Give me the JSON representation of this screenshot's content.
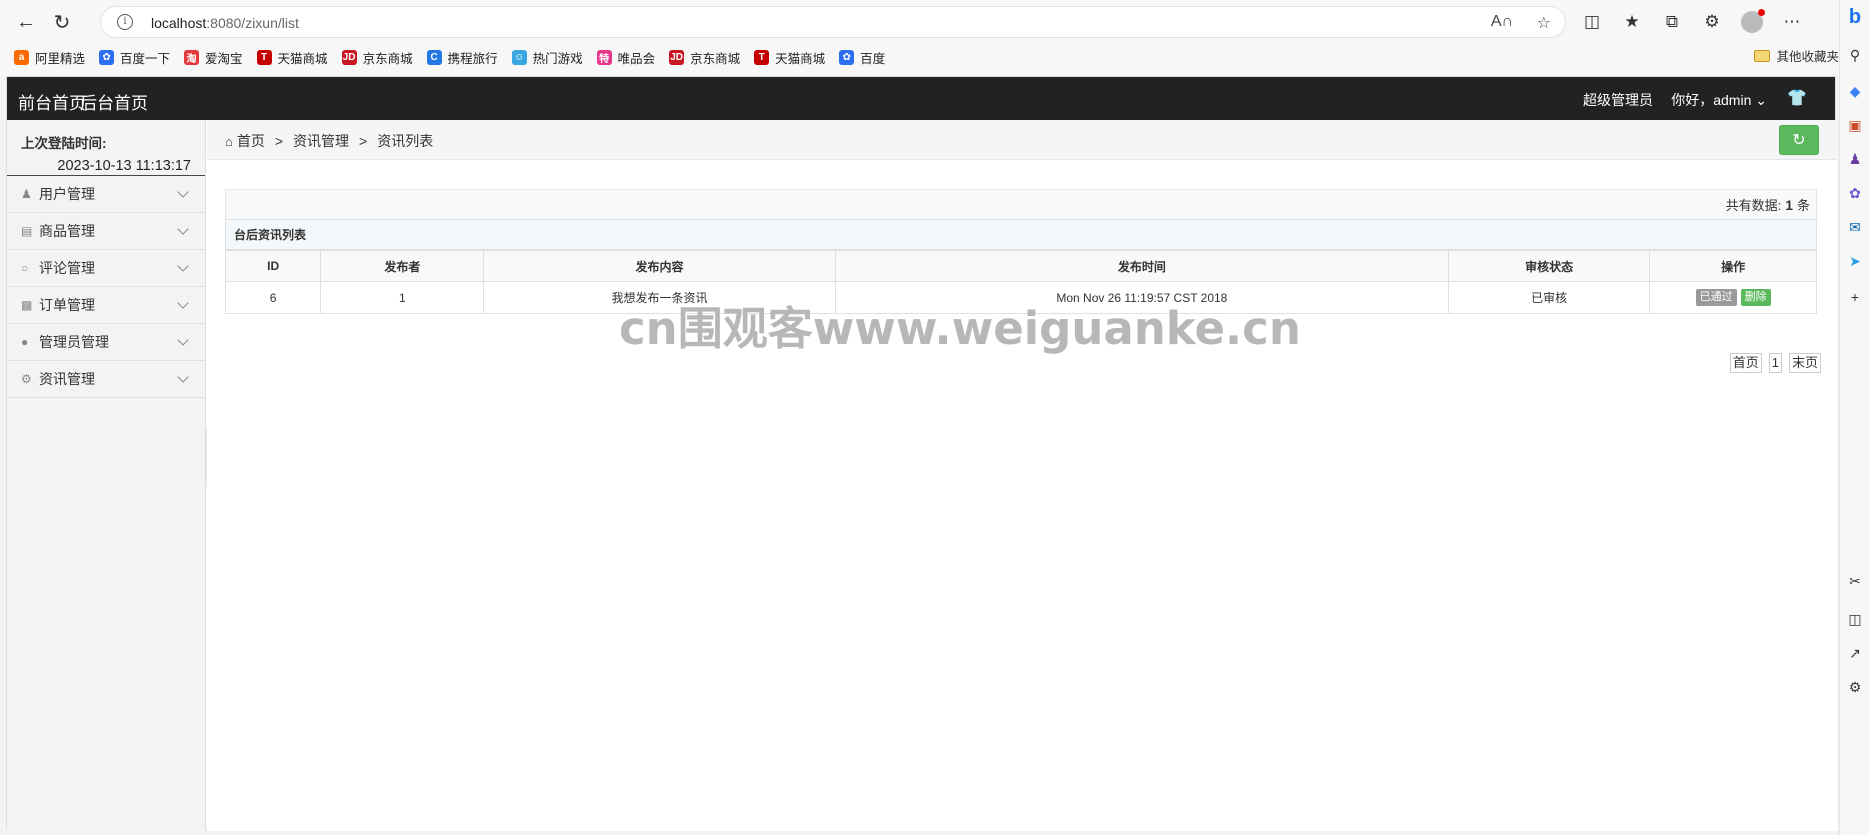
{
  "browser": {
    "url_host": "localhost",
    "url_rest": ":8080/zixun/list",
    "bookmarks": [
      {
        "label": "阿里精选",
        "color": "#ff6a00",
        "glyph": "a"
      },
      {
        "label": "百度一下",
        "color": "#2d6ff0",
        "glyph": "✿"
      },
      {
        "label": "爱淘宝",
        "color": "#e4393c",
        "glyph": "淘"
      },
      {
        "label": "天猫商城",
        "color": "#c40000",
        "glyph": "T"
      },
      {
        "label": "京东商城",
        "color": "#c81623",
        "glyph": "JD"
      },
      {
        "label": "携程旅行",
        "color": "#2577e3",
        "glyph": "C"
      },
      {
        "label": "热门游戏",
        "color": "#3aa7e0",
        "glyph": "☺"
      },
      {
        "label": "唯品会",
        "color": "#e8368b",
        "glyph": "特"
      },
      {
        "label": "京东商城",
        "color": "#c81623",
        "glyph": "JD"
      },
      {
        "label": "天猫商城",
        "color": "#c40000",
        "glyph": "T"
      },
      {
        "label": "百度",
        "color": "#2d6ff0",
        "glyph": "✿"
      }
    ],
    "other_bookmarks": "其他收藏夹"
  },
  "topbar": {
    "front_home": "前台首页",
    "back_home": "后台首页",
    "role": "超级管理员",
    "greeting": "你好，admin"
  },
  "sidebar": {
    "last_login_label": "上次登陆时间:",
    "last_login_time": "2023-10-13 11:13:17",
    "items": [
      {
        "label": "用户管理",
        "icon": "user-icon"
      },
      {
        "label": "商品管理",
        "icon": "bag-icon"
      },
      {
        "label": "评论管理",
        "icon": "comment-icon"
      },
      {
        "label": "订单管理",
        "icon": "card-icon"
      },
      {
        "label": "管理员管理",
        "icon": "admin-icon"
      },
      {
        "label": "资讯管理",
        "icon": "gear-icon"
      }
    ]
  },
  "breadcrumb": {
    "home": "首页",
    "level1": "资讯管理",
    "level2": "资讯列表",
    "sep": ">"
  },
  "list": {
    "total_prefix": "共有数据:",
    "total_count": "1",
    "total_suffix": "条",
    "title": "台后资讯列表",
    "columns": [
      "ID",
      "发布者",
      "发布内容",
      "发布时间",
      "审核状态",
      "操作"
    ],
    "rows": [
      {
        "id": "6",
        "publisher": "1",
        "content": "我想发布一条资讯",
        "time": "Mon Nov 26 11:19:57 CST 2018",
        "status": "已审核",
        "action_passed": "已通过",
        "action_delete": "删除"
      }
    ]
  },
  "watermark": "cn围观客www.weiguanke.cn",
  "pager": {
    "first": "首页",
    "current": "1",
    "last": "末页"
  }
}
